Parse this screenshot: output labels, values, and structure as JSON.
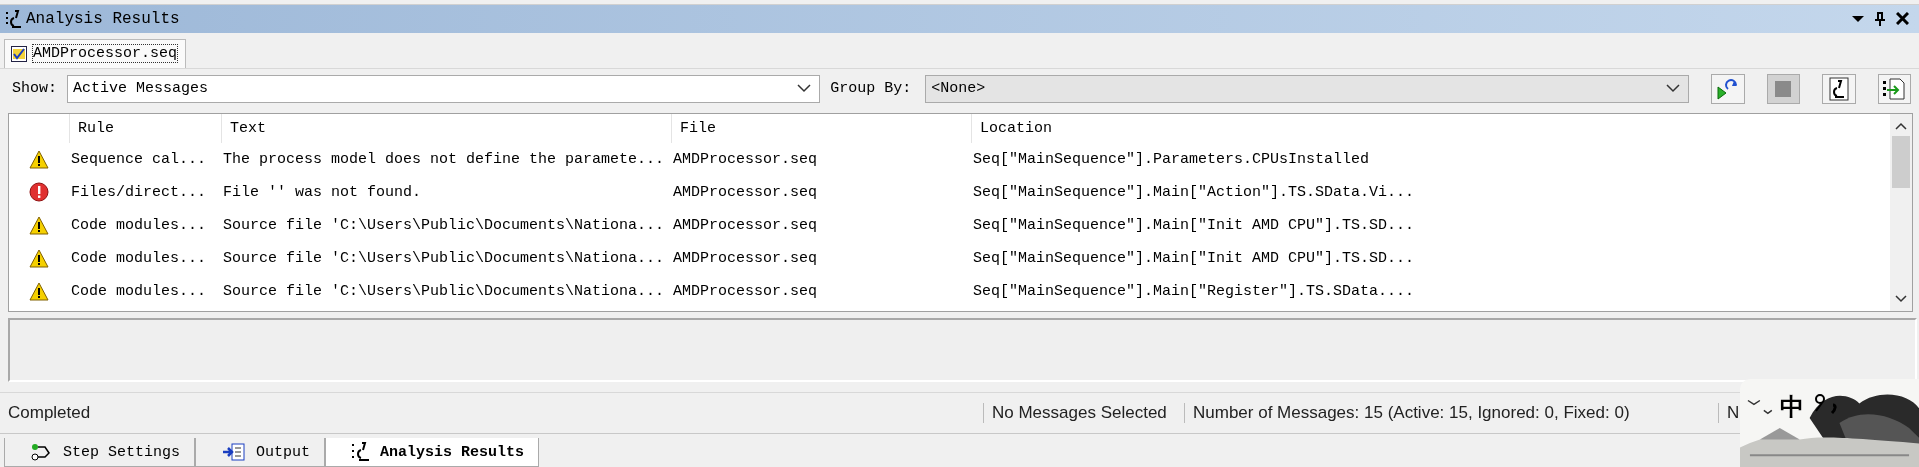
{
  "panel": {
    "title": "Analysis Results"
  },
  "file_tabs": [
    {
      "label": "AMDProcessor.seq",
      "selected": true
    }
  ],
  "filters": {
    "show_label": "Show:",
    "show_value": "Active Messages",
    "group_label": "Group By:",
    "group_value": "<None>"
  },
  "toolbar": [
    {
      "kind": "run",
      "disabled": false
    },
    {
      "kind": "stop",
      "disabled": true
    },
    {
      "kind": "analyze",
      "disabled": false
    },
    {
      "kind": "export",
      "disabled": false
    }
  ],
  "table": {
    "columns": [
      "Rule",
      "Text",
      "File",
      "Location"
    ],
    "rows": [
      {
        "kind": "warning",
        "rule": "Sequence cal...",
        "text": "The process model does not define the paramete...",
        "file": "AMDProcessor.seq",
        "location": "Seq[\"MainSequence\"].Parameters.CPUsInstalled"
      },
      {
        "kind": "error",
        "rule": "Files/direct...",
        "text": "File '' was not found.",
        "file": "AMDProcessor.seq",
        "location": "Seq[\"MainSequence\"].Main[\"Action\"].TS.SData.Vi..."
      },
      {
        "kind": "warning",
        "rule": "Code modules...",
        "text": "Source file 'C:\\Users\\Public\\Documents\\Nationa...",
        "file": "AMDProcessor.seq",
        "location": "Seq[\"MainSequence\"].Main[\"Init AMD CPU\"].TS.SD..."
      },
      {
        "kind": "warning",
        "rule": "Code modules...",
        "text": "Source file 'C:\\Users\\Public\\Documents\\Nationa...",
        "file": "AMDProcessor.seq",
        "location": "Seq[\"MainSequence\"].Main[\"Init AMD CPU\"].TS.SD..."
      },
      {
        "kind": "warning",
        "rule": "Code modules...",
        "text": "Source file 'C:\\Users\\Public\\Documents\\Nationa...",
        "file": "AMDProcessor.seq",
        "location": "Seq[\"MainSequence\"].Main[\"Register\"].TS.SData...."
      }
    ]
  },
  "status_bar": [
    "Completed",
    "No Messages Selected",
    "Number of Messages: 15 (Active: 15, Ignored: 0, Fixed: 0)",
    "N"
  ],
  "bottom_tabs": [
    {
      "kind": "steps",
      "label": "Step Settings",
      "selected": false
    },
    {
      "kind": "output",
      "label": "Output",
      "selected": false
    },
    {
      "kind": "analysis",
      "label": "Analysis Results",
      "selected": true
    }
  ],
  "ime_bar": {
    "mode": "中"
  }
}
